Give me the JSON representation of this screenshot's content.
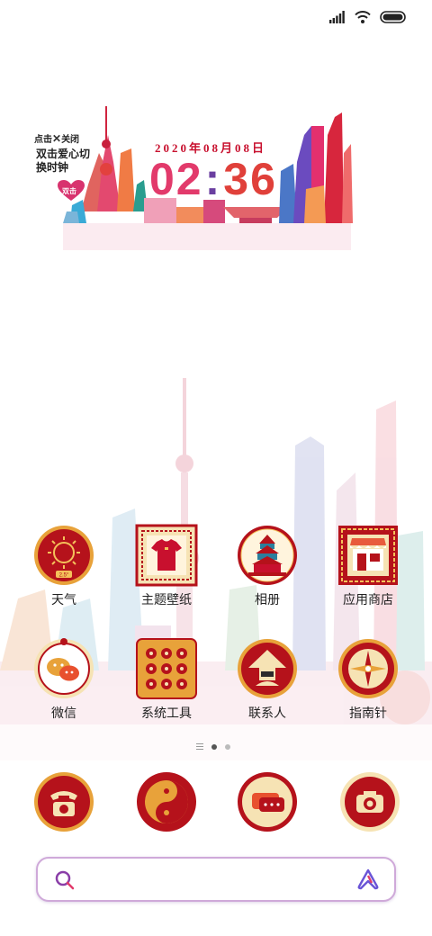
{
  "status_bar": {
    "icons": [
      "signal-icon",
      "wifi-icon",
      "battery-icon"
    ]
  },
  "widget": {
    "close_hint_prefix": "点击",
    "close_hint_mark": "✕",
    "close_hint_suffix": "关闭",
    "title": "双击爱心切换时钟",
    "heart_label": "双击",
    "date": "2020年08月08日",
    "hour": "02",
    "minute": "36"
  },
  "apps": [
    {
      "label": "天气",
      "icon": "weather-sun-icon",
      "badge": "2.5°"
    },
    {
      "label": "主题壁纸",
      "icon": "theme-tshirt-icon"
    },
    {
      "label": "相册",
      "icon": "gallery-temple-icon"
    },
    {
      "label": "应用商店",
      "icon": "app-store-shop-icon"
    },
    {
      "label": "微信",
      "icon": "wechat-chat-icon"
    },
    {
      "label": "系统工具",
      "icon": "system-tools-folder-icon"
    },
    {
      "label": "联系人",
      "icon": "contacts-person-icon"
    },
    {
      "label": "指南针",
      "icon": "compass-icon"
    }
  ],
  "dock": [
    {
      "icon": "phone-icon"
    },
    {
      "icon": "yin-yang-icon"
    },
    {
      "icon": "messages-icon"
    },
    {
      "icon": "camera-icon"
    }
  ],
  "search": {
    "placeholder": ""
  },
  "colors": {
    "red": "#b5121b",
    "gold": "#e8a23a",
    "cream": "#f6e3b4",
    "border": "#cfa9d9"
  }
}
